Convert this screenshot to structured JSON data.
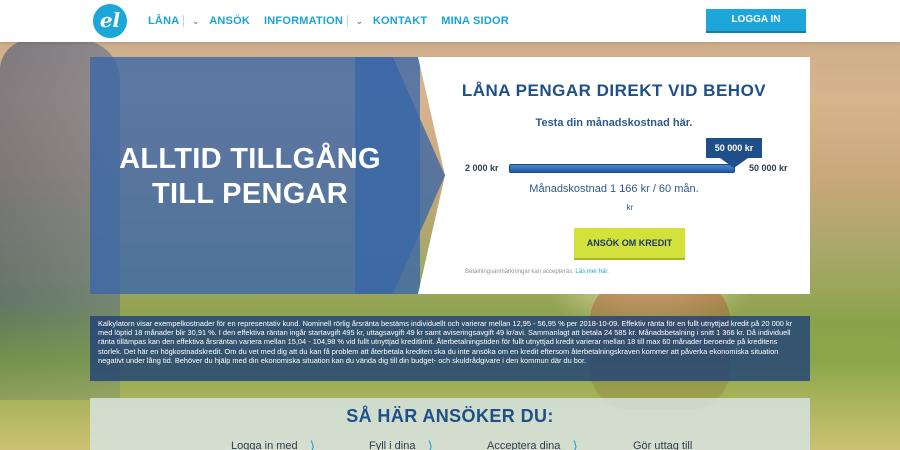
{
  "header": {
    "logo_text": "el",
    "nav": [
      {
        "label": "LÅNA",
        "has_dropdown": true
      },
      {
        "label": "ANSÖK",
        "has_dropdown": false
      },
      {
        "label": "INFORMATION",
        "has_dropdown": true
      },
      {
        "label": "KONTAKT",
        "has_dropdown": false
      },
      {
        "label": "MINA SIDOR",
        "has_dropdown": false
      }
    ],
    "login_label": "LOGGA IN"
  },
  "hero": {
    "title_line1": "ALLTID TILLGÅNG",
    "title_line2": "TILL PENGAR"
  },
  "calculator": {
    "title": "LÅNA PENGAR DIREKT VID BEHOV",
    "subtitle": "Testa din månadskostnad här.",
    "slider": {
      "min_label": "2 000 kr",
      "max_label": "50 000 kr",
      "value_label": "50 000 kr",
      "level": 1.0
    },
    "monthly_cost": "Månadskostnad 1 166 kr / 60 mån.",
    "monthly_unit": "kr",
    "apply_label": "ANSÖK OM KREDIT",
    "fineprint": "Betalningsanmärkningar kan accepteras.",
    "fineprint_link": "Läs mer här."
  },
  "disclaimer": "Kalkylatorn visar exempelkostnader för en representativ kund. Nominell rörlig årsränta bestäms individuellt och varierar mellan 12,95 - 56,95 % per 2018-10-09. Effektiv ränta för en fullt utnyttjad kredit på 20 000 kr med löptid 18 månader blir 30,91 %. I den effektiva räntan ingår startavgift 495 kr, uttagsavgift 49 kr samt aviseringsavgift 49 kr/avi. Sammanlagt att betala 24 585 kr. Månadsbetalning i snitt 1 366 kr. Då individuell ränta tillämpas kan den effektiva årsräntan variera mellan 15,04 - 104,98 % vid fullt utnyttjad kreditlimit. Återbetalningstiden för fullt utnyttjad kredit varierar mellan 18 till max 60 månader beroende på kreditens storlek. Det här en högkostnadskredit. Om du vet med dig att du kan få problem att återbetala krediten ska du inte ansöka om en kredit eftersom återbetalningskraven kommer att påverka ekonomiska situation negativt under lång tid. Behöver du hjälp med din ekonomiska situation kan du vända dig till din budget- och skuldrådgivare i den kommun där du bor.",
  "howto": {
    "title": "SÅ HÄR ANSÖKER DU:",
    "steps": [
      "Logga in med",
      "Fyll i dina",
      "Acceptera dina",
      "Gör uttag till"
    ]
  },
  "colors": {
    "brand": "#1ca6d9",
    "navy": "#1f4f88",
    "apply_button": "#d3e13b"
  }
}
